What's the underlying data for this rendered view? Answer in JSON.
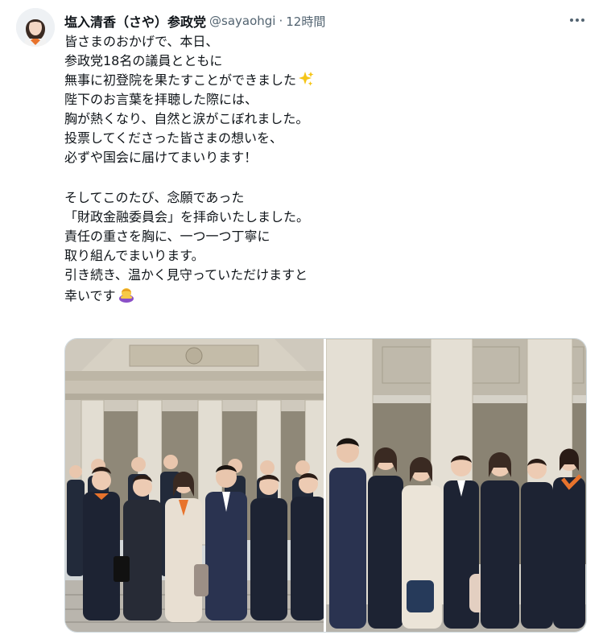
{
  "author": {
    "display_name": "塩入清香（さや）参政党",
    "handle": "@sayaohgi",
    "separator": "·",
    "time": "12時間"
  },
  "tweet": {
    "lines": [
      "皆さまのおかげで、本日、",
      "参政党18名の議員とともに",
      "無事に初登院を果たすことができました",
      "陛下のお言葉を拝聴した際には、",
      "胸が熱くなり、自然と涙がこぼれました。",
      "投票してくださった皆さまの想いを、",
      "必ずや国会に届けてまいります！",
      "",
      "そしてこのたび、念願であった",
      "「財政金融委員会」を拝命いたしました。",
      "責任の重さを胸に、一つ一つ丁寧に",
      "取り組んでまいります。",
      "引き続き、温かく見守っていただけますと",
      "幸いです"
    ]
  },
  "icons": {
    "sparkles": "sparkles-emoji",
    "bowing": "bowing-person-emoji",
    "more": "more-options-icon"
  },
  "colors": {
    "text": "#0f1419",
    "secondary": "#536471",
    "border": "#cfd9de",
    "scarf_orange": "#e8732c"
  }
}
